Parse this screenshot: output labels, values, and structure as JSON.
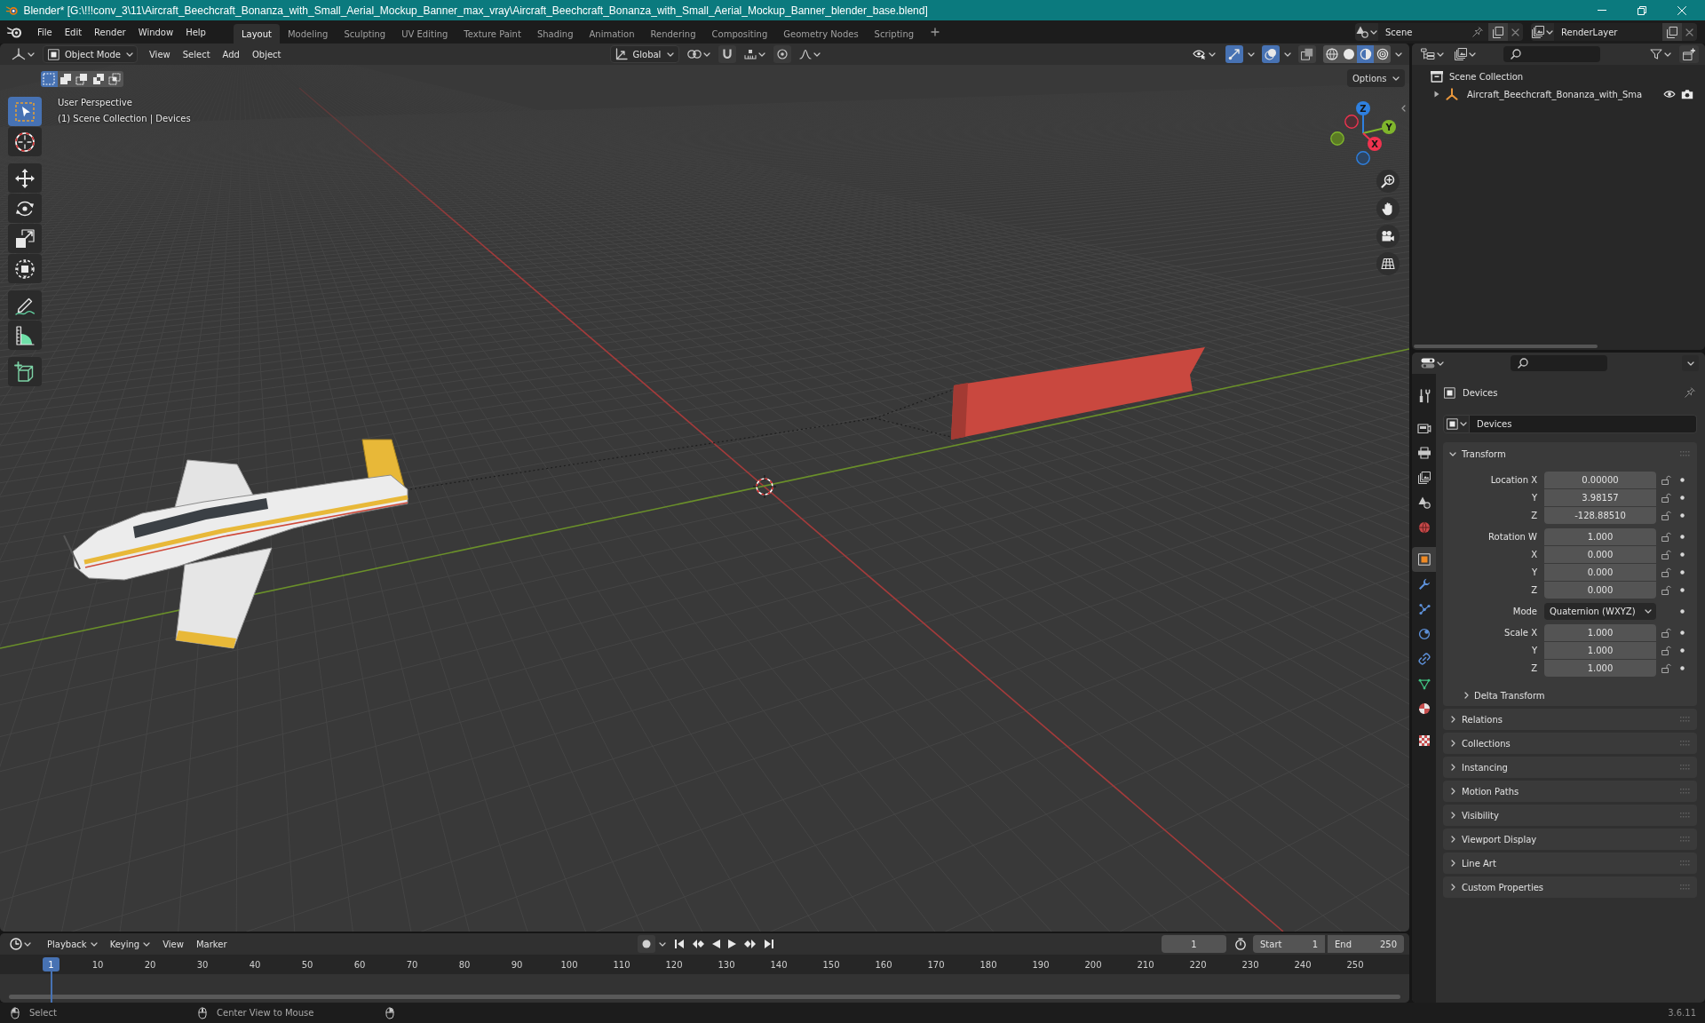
{
  "window": {
    "title": "Blender* [G:\\!!!conv_3\\11\\Aircraft_Beechcraft_Bonanza_with_Small_Aerial_Mockup_Banner_max_vray\\Aircraft_Beechcraft_Bonanza_with_Small_Aerial_Mockup_Banner_blender_base.blend]"
  },
  "menu": [
    "File",
    "Edit",
    "Render",
    "Window",
    "Help"
  ],
  "workspaces": [
    {
      "label": "Layout",
      "selected": true
    },
    {
      "label": "Modeling",
      "selected": false
    },
    {
      "label": "Sculpting",
      "selected": false
    },
    {
      "label": "UV Editing",
      "selected": false
    },
    {
      "label": "Texture Paint",
      "selected": false
    },
    {
      "label": "Shading",
      "selected": false
    },
    {
      "label": "Animation",
      "selected": false
    },
    {
      "label": "Rendering",
      "selected": false
    },
    {
      "label": "Compositing",
      "selected": false
    },
    {
      "label": "Geometry Nodes",
      "selected": false
    },
    {
      "label": "Scripting",
      "selected": false
    }
  ],
  "scene": {
    "name": "Scene",
    "view_layer": "RenderLayer"
  },
  "viewport": {
    "mode": "Object Mode",
    "menus": [
      "View",
      "Select",
      "Add",
      "Object"
    ],
    "orientation": "Global",
    "header_toggles": [
      {
        "kind": "gizmos",
        "on": true
      },
      {
        "kind": "overlays",
        "on": true
      },
      {
        "kind": "xray",
        "on": false
      }
    ],
    "shading": [
      {
        "kind": "wireframe",
        "selected": false
      },
      {
        "kind": "solid",
        "selected": false
      },
      {
        "kind": "material",
        "selected": true
      },
      {
        "kind": "rendered",
        "selected": false
      }
    ],
    "options": "Options",
    "select_modes": [
      {
        "kind": "set",
        "selected": true
      },
      {
        "kind": "extend",
        "selected": false
      },
      {
        "kind": "subtract",
        "selected": false
      },
      {
        "kind": "invert",
        "selected": false
      },
      {
        "kind": "intersect",
        "selected": false
      }
    ],
    "tool_groups": [
      [
        {
          "kind": "select",
          "selected": true
        },
        {
          "kind": "cursor",
          "selected": false
        }
      ],
      [
        {
          "kind": "move",
          "selected": false
        },
        {
          "kind": "rotate",
          "selected": false
        },
        {
          "kind": "scale",
          "selected": false
        },
        {
          "kind": "transform",
          "selected": false
        }
      ],
      [
        {
          "kind": "annotate",
          "selected": false
        },
        {
          "kind": "measure",
          "selected": false
        }
      ],
      [
        {
          "kind": "add_cube",
          "selected": false
        }
      ]
    ],
    "overlay_text": [
      "User Perspective",
      "(1) Scene Collection | Devices"
    ],
    "gizmo_axes": [
      {
        "kind": "z",
        "label": "Z"
      },
      {
        "kind": "y",
        "label": "Y"
      },
      {
        "kind": "x",
        "label": "X"
      }
    ]
  },
  "outliner": {
    "items": [
      {
        "label": "Scene Collection",
        "children": [
          {
            "label": "Aircraft_Beechcraft_Bonanza_with_Sma",
            "expanded": false,
            "visible": true
          }
        ]
      }
    ]
  },
  "properties": {
    "tab_groups": [
      [
        {
          "kind": "tool",
          "selected": false
        }
      ],
      [
        {
          "kind": "render",
          "selected": false
        },
        {
          "kind": "output",
          "selected": false
        },
        {
          "kind": "view_layer",
          "selected": false
        },
        {
          "kind": "scene",
          "selected": false
        },
        {
          "kind": "world",
          "selected": false
        }
      ],
      [
        {
          "kind": "object",
          "selected": true
        },
        {
          "kind": "modifiers",
          "selected": false
        },
        {
          "kind": "particles",
          "selected": false
        },
        {
          "kind": "physics",
          "selected": false
        },
        {
          "kind": "constraints",
          "selected": false
        },
        {
          "kind": "data",
          "selected": false
        },
        {
          "kind": "material",
          "selected": false
        }
      ],
      [
        {
          "kind": "texture",
          "selected": false
        }
      ]
    ],
    "context": "Devices",
    "object_name": "Devices",
    "panels": [
      {
        "title": "Transform",
        "expanded": true,
        "groups": [
          {
            "rows": [
              {
                "kind": "number",
                "label": "Location X",
                "value": "0.00000"
              },
              {
                "kind": "number",
                "label": "Y",
                "value": "3.98157"
              },
              {
                "kind": "number",
                "label": "Z",
                "value": "-128.88510"
              }
            ]
          },
          {
            "rows": [
              {
                "kind": "number",
                "label": "Rotation W",
                "value": "1.000"
              },
              {
                "kind": "number",
                "label": "X",
                "value": "0.000"
              },
              {
                "kind": "number",
                "label": "Y",
                "value": "0.000"
              },
              {
                "kind": "number",
                "label": "Z",
                "value": "0.000"
              }
            ]
          },
          {
            "rows": [
              {
                "kind": "dropdown",
                "label": "Mode",
                "value": "Quaternion (WXYZ)"
              }
            ]
          },
          {
            "rows": [
              {
                "kind": "number",
                "label": "Scale X",
                "value": "1.000"
              },
              {
                "kind": "number",
                "label": "Y",
                "value": "1.000"
              },
              {
                "kind": "number",
                "label": "Z",
                "value": "1.000"
              }
            ]
          }
        ],
        "subpanels": [
          {
            "title": "Delta Transform",
            "expanded": false
          }
        ]
      },
      {
        "title": "Relations",
        "expanded": false
      },
      {
        "title": "Collections",
        "expanded": false
      },
      {
        "title": "Instancing",
        "expanded": false
      },
      {
        "title": "Motion Paths",
        "expanded": false
      },
      {
        "title": "Visibility",
        "expanded": false
      },
      {
        "title": "Viewport Display",
        "expanded": false
      },
      {
        "title": "Line Art",
        "expanded": false
      },
      {
        "title": "Custom Properties",
        "expanded": false
      }
    ]
  },
  "timeline": {
    "menus": [
      {
        "label": "Playback",
        "dropdown": true
      },
      {
        "label": "Keying",
        "dropdown": true
      },
      {
        "label": "View",
        "dropdown": false
      },
      {
        "label": "Marker",
        "dropdown": false
      }
    ],
    "current_frame": "1",
    "start_label": "Start",
    "start": "1",
    "end_label": "End",
    "end": "250",
    "playhead": "1",
    "ruler": [
      "10",
      "20",
      "30",
      "40",
      "50",
      "60",
      "70",
      "80",
      "90",
      "100",
      "110",
      "120",
      "130",
      "140",
      "150",
      "160",
      "170",
      "180",
      "190",
      "200",
      "210",
      "220",
      "230",
      "240",
      "250"
    ]
  },
  "status_bar": {
    "hints": [
      {
        "kind": "left_click",
        "label": "Select"
      },
      {
        "kind": "middle_click",
        "label": "Center View to Mouse"
      },
      {
        "kind": "right_click"
      }
    ],
    "version": "3.6.11"
  }
}
